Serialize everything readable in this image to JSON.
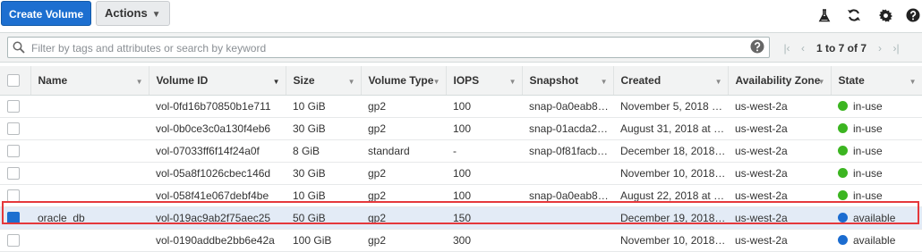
{
  "toolbar": {
    "create_label": "Create Volume",
    "actions_label": "Actions"
  },
  "icons": {
    "flask": "flask-icon",
    "refresh": "refresh-icon",
    "gear": "gear-icon",
    "help": "help-icon",
    "search": "search-icon",
    "first": "first-page-icon",
    "prev": "prev-page-icon",
    "next": "next-page-icon",
    "last": "last-page-icon"
  },
  "search": {
    "placeholder": "Filter by tags and attributes or search by keyword",
    "value": ""
  },
  "pagination": {
    "text": "1 to 7 of 7"
  },
  "columns": [
    "Name",
    "Volume ID",
    "Size",
    "Volume Type",
    "IOPS",
    "Snapshot",
    "Created",
    "Availability Zone",
    "State"
  ],
  "rows": [
    {
      "name": "",
      "volume_id": "vol-0fd16b70850b1e711",
      "size": "10 GiB",
      "type": "gp2",
      "iops": "100",
      "snapshot": "snap-0a0eab8…",
      "created": "November 5, 2018 …",
      "az": "us-west-2a",
      "state": "in-use",
      "state_color": "green",
      "selected": false
    },
    {
      "name": "",
      "volume_id": "vol-0b0ce3c0a130f4eb6",
      "size": "30 GiB",
      "type": "gp2",
      "iops": "100",
      "snapshot": "snap-01acda2…",
      "created": "August 31, 2018 at …",
      "az": "us-west-2a",
      "state": "in-use",
      "state_color": "green",
      "selected": false
    },
    {
      "name": "",
      "volume_id": "vol-07033ff6f14f24a0f",
      "size": "8 GiB",
      "type": "standard",
      "iops": "-",
      "snapshot": "snap-0f81facb…",
      "created": "December 18, 2018…",
      "az": "us-west-2a",
      "state": "in-use",
      "state_color": "green",
      "selected": false
    },
    {
      "name": "",
      "volume_id": "vol-05a8f1026cbec146d",
      "size": "30 GiB",
      "type": "gp2",
      "iops": "100",
      "snapshot": "",
      "created": "November 10, 2018…",
      "az": "us-west-2a",
      "state": "in-use",
      "state_color": "green",
      "selected": false
    },
    {
      "name": "",
      "volume_id": "vol-058f41e067debf4be",
      "size": "10 GiB",
      "type": "gp2",
      "iops": "100",
      "snapshot": "snap-0a0eab8…",
      "created": "August 22, 2018 at …",
      "az": "us-west-2a",
      "state": "in-use",
      "state_color": "green",
      "selected": false
    },
    {
      "name": "oracle_db",
      "volume_id": "vol-019ac9ab2f75aec25",
      "size": "50 GiB",
      "type": "gp2",
      "iops": "150",
      "snapshot": "",
      "created": "December 19, 2018…",
      "az": "us-west-2a",
      "state": "available",
      "state_color": "blue",
      "selected": true
    },
    {
      "name": "",
      "volume_id": "vol-0190addbe2bb6e42a",
      "size": "100 GiB",
      "type": "gp2",
      "iops": "300",
      "snapshot": "",
      "created": "November 10, 2018…",
      "az": "us-west-2a",
      "state": "available",
      "state_color": "blue",
      "selected": false
    }
  ],
  "colors": {
    "primary": "#1d6fd0",
    "in_use": "#3cb521",
    "available": "#1b6cd0",
    "highlight": "#e5383b"
  }
}
